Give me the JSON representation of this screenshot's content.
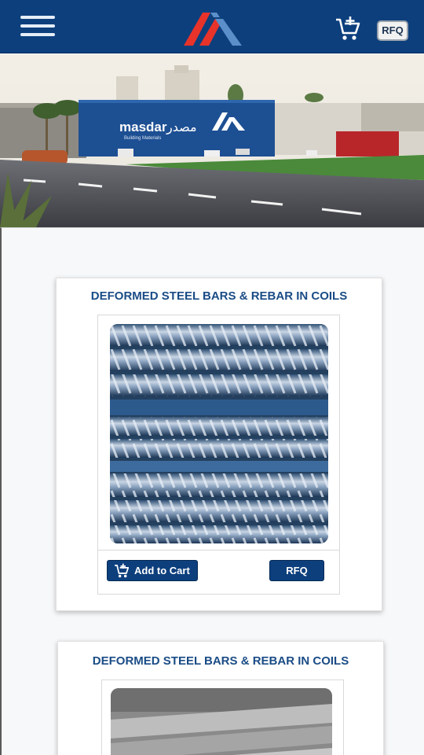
{
  "header": {
    "menu_icon": "hamburger-menu-icon",
    "logo_icon": "masdar-logo-icon",
    "cart_icon": "add-to-cart-icon",
    "rfq_label": "RFQ"
  },
  "banner": {
    "brand_text": "masdar",
    "brand_arabic": "مصدر",
    "brand_subtitle": "Building Materials"
  },
  "products": [
    {
      "title": "DEFORMED STEEL BARS & REBAR IN COILS",
      "add_to_cart_label": "Add to Cart",
      "rfq_label": "RFQ"
    },
    {
      "title": "DEFORMED STEEL BARS & REBAR IN COILS"
    }
  ],
  "colors": {
    "header_bg": "#0d3f7d",
    "title_blue": "#1a4c86",
    "logo_red": "#e8332a",
    "logo_blue": "#5b8fc9"
  }
}
